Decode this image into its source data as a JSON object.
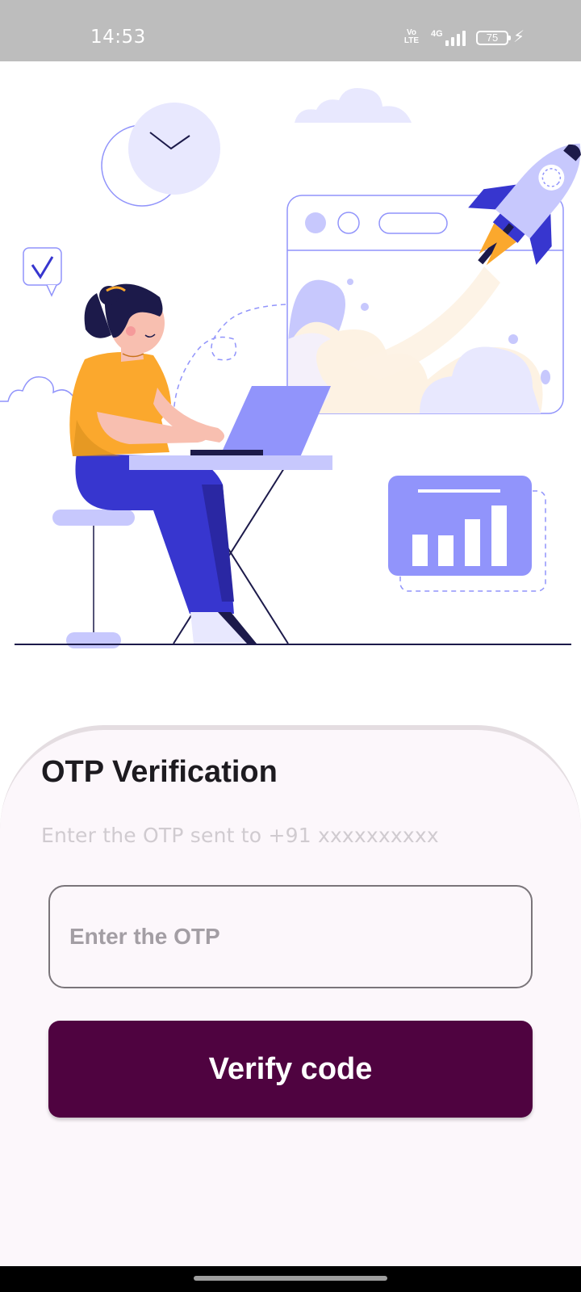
{
  "status_bar": {
    "time": "14:53",
    "volte_label": "Vo LTE",
    "network_label": "4G",
    "battery_level": "75"
  },
  "illustration": {
    "description_icon_names": [
      "clock-icon",
      "cloud-icon",
      "check-chat-icon",
      "browser-window",
      "rocket-icon",
      "person-laptop",
      "bar-chart-icon"
    ],
    "colors": {
      "lavender": "#e8e8fe",
      "periwinkle": "#9194fb",
      "indigo": "#3736cf",
      "navy": "#1c1a4a",
      "orange": "#fba82d",
      "cream": "#fdf2e3"
    }
  },
  "otp": {
    "title": "OTP Verification",
    "subtitle": "Enter the OTP sent to +91 xxxxxxxxxx",
    "input_placeholder": "Enter the OTP",
    "input_value": "",
    "verify_label": "Verify code"
  },
  "theme": {
    "primary": "#4f0340",
    "card_background": "#fcf7fb"
  }
}
